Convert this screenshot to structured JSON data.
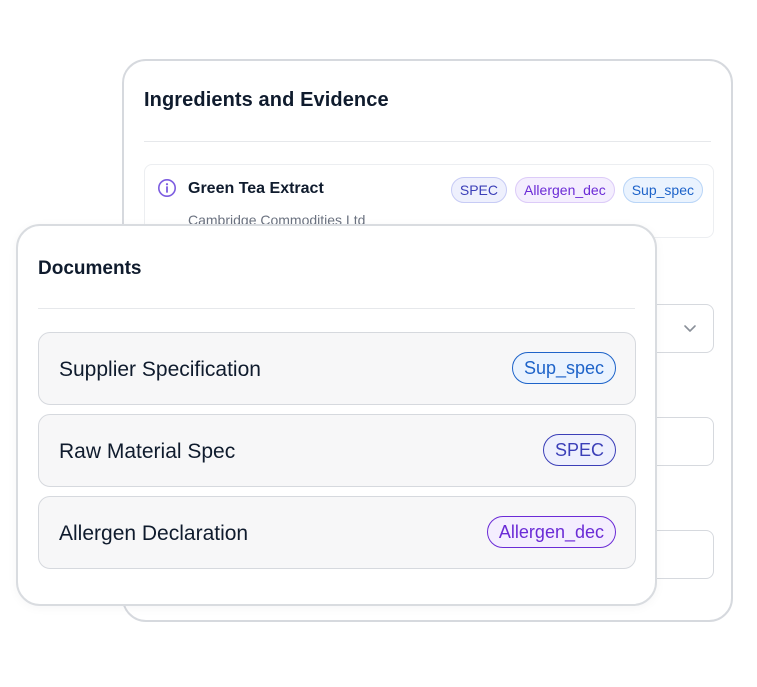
{
  "ingredients_card": {
    "title": "Ingredients and Evidence",
    "ingredient": {
      "name": "Green Tea Extract",
      "supplier": "Cambridge Commodities Ltd",
      "icon": "info-icon",
      "tags": [
        "SPEC",
        "Allergen_dec",
        "Sup_spec"
      ]
    },
    "dropdown_icon": "chevron-down-icon"
  },
  "documents_card": {
    "title": "Documents",
    "documents": [
      {
        "name": "Supplier Specification",
        "tag": "Sup_spec"
      },
      {
        "name": "Raw Material Spec",
        "tag": "SPEC"
      },
      {
        "name": "Allergen Declaration",
        "tag": "Allergen_dec"
      }
    ]
  },
  "colors": {
    "text_primary": "#0f1b2d",
    "text_secondary": "#6b7280",
    "info_icon": "#7c5ce0",
    "spec_tag": "#3b3fb8",
    "allergen_tag": "#6b2bd6",
    "sup_spec_tag": "#1d63c9",
    "border": "#d6d9de",
    "row_background": "#f7f7f8"
  }
}
